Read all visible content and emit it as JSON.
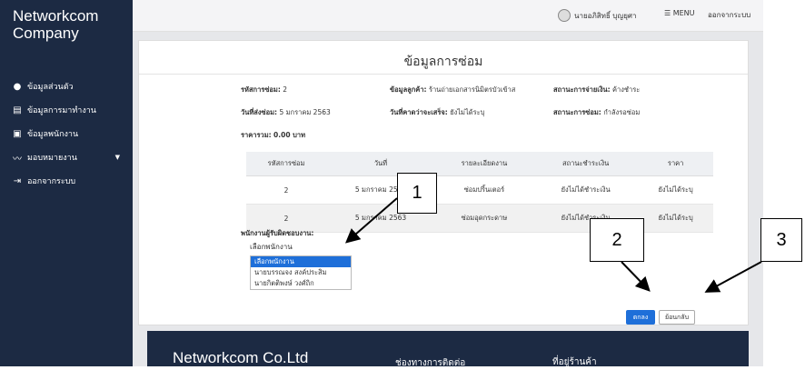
{
  "sidebar": {
    "brand": "Networkcom Company",
    "items": [
      {
        "icon": "user-circle-icon",
        "glyph": "●",
        "label": "ข้อมูลส่วนตัว"
      },
      {
        "icon": "document-icon",
        "glyph": "▤",
        "label": "ข้อมูลการมาทำงาน"
      },
      {
        "icon": "id-card-icon",
        "glyph": "▣",
        "label": "ข้อมูลพนักงาน"
      },
      {
        "icon": "chart-line-icon",
        "glyph": "〰",
        "label": "มอบหมายงาน"
      },
      {
        "icon": "sign-out-icon",
        "glyph": "⇥",
        "label": "ออกจากระบบ"
      }
    ]
  },
  "topbar": {
    "user_name": "นายอภิสิทธิ์ บุญยุศา",
    "menu_label": "MENU",
    "logout_label": "ออกจากระบบ"
  },
  "card": {
    "title": "ข้อมูลการซ่อม",
    "repair_id_label": "รหัสการซ่อม:",
    "repair_id": "2",
    "customer_label": "ข้อมูลลูกค้า:",
    "customer": "ร้านถ่ายเอกสารนิมิตรบัวเข้าส",
    "payment_status_label": "สถานะการจ่ายเงิน:",
    "payment_status": "ค้างชำระ",
    "send_date_label": "วันที่ส่งซ่อม:",
    "send_date": "5 มกราคม 2563",
    "finish_date_label": "วันที่คาดว่าจะเสร็จ:",
    "finish_date": "ยังไม่ได้ระบุ",
    "repair_status_label": "สถานะการซ่อม:",
    "repair_status": "กำลังรอซ่อม",
    "total_label": "ราคารวม:",
    "total": "0.00 บาท"
  },
  "table": {
    "headers": [
      "รหัสการซ่อม",
      "วันที่",
      "รายละเอียดงาน",
      "สถานะชำระเงิน",
      "ราคา"
    ],
    "rows": [
      [
        "2",
        "5 มกราคม 2563",
        "ซ่อมปริ้นเตอร์",
        "ยังไม่ได้ชำระเงิน",
        "ยังไม่ได้ระบุ"
      ],
      [
        "2",
        "5 มกราคม 2563",
        "ซ่อมอุดกระดาษ",
        "ยังไม่ได้ชำระเงิน",
        "ยังไม่ได้ระบุ"
      ]
    ]
  },
  "employee": {
    "label": "พนักงานผู้รับผิดชอบงาน:",
    "selected": "เลือกพนักงาน",
    "options": [
      "เลือกพนักงาน",
      "นายบรรณจง สงค์ประสิม",
      "นายกิตติพงษ์ วงศ์ถิก"
    ]
  },
  "buttons": {
    "save": "ตกลง",
    "back": "ย้อนกลับ"
  },
  "footer": {
    "company": "Networkcom Co.Ltd",
    "contact": "ช่องทางการติดต่อ",
    "address": "ที่อยู่ร้านค้า"
  },
  "callouts": [
    "1",
    "2",
    "3"
  ]
}
